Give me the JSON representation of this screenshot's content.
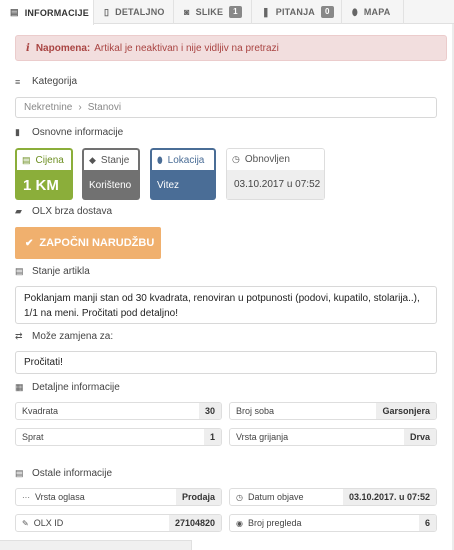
{
  "tabs": [
    {
      "label": "INFORMACIJE",
      "icon": "list-icon",
      "glyph": "▤",
      "active": true
    },
    {
      "label": "DETALJNO",
      "icon": "document-icon",
      "glyph": "▯",
      "active": false
    },
    {
      "label": "SLIKE",
      "icon": "camera-icon",
      "glyph": "◙",
      "badge": "1",
      "active": false
    },
    {
      "label": "PITANJA",
      "icon": "comments-icon",
      "glyph": "❚",
      "badge": "0",
      "active": false
    },
    {
      "label": "MAPA",
      "icon": "map-marker-icon",
      "glyph": "⬮",
      "active": false
    }
  ],
  "alert": {
    "bold": "Napomena:",
    "text": "Artikal je neaktivan i nije vidljiv na pretrazi",
    "icon": "info-icon",
    "glyph": "i"
  },
  "kategorija": {
    "heading": "Kategorija",
    "icon": "bars-icon",
    "glyph": "≡",
    "path": [
      "Nekretnine",
      "Stanovi"
    ],
    "separator": "›"
  },
  "osnovne": {
    "heading": "Osnovne informacije",
    "icon": "file-icon",
    "glyph": "▮",
    "cards": [
      {
        "label": "Cijena",
        "value": "1 KM",
        "icon": "money-icon",
        "glyph": "▤",
        "color": "#8bae3a"
      },
      {
        "label": "Stanje",
        "value": "Korišteno",
        "icon": "tag-icon",
        "glyph": "◆",
        "color": "#717171"
      },
      {
        "label": "Lokacija",
        "value": "Vitez",
        "icon": "map-pin-icon",
        "glyph": "⬮",
        "color": "#4a6d96"
      },
      {
        "label": "Obnovljen",
        "value": "03.10.2017 u 07:52",
        "icon": "clock-icon",
        "glyph": "◷",
        "color": "#eeeeee"
      }
    ]
  },
  "dostava": {
    "heading": "OLX brza dostava",
    "icon": "truck-icon",
    "glyph": "▰",
    "button": "ZAPOČNI NARUDŽBU",
    "button_icon": "check-icon",
    "button_glyph": "✔",
    "button_color": "#f0b06e"
  },
  "stanje": {
    "heading": "Stanje artikla",
    "icon": "file-text-icon",
    "glyph": "▤",
    "text": "Poklanjam manji stan od 30 kvadrata, renoviran u potpunosti (podovi, kupatilo, stolarija..), 1/1 na meni. Pročitati pod detaljno!"
  },
  "zamjena": {
    "heading": "Može zamjena za:",
    "icon": "exchange-icon",
    "glyph": "⇄",
    "value": "Pročitati!"
  },
  "detaljne": {
    "heading": "Detaljne informacije",
    "icon": "table-icon",
    "glyph": "▦",
    "items": [
      {
        "label": "Kvadrata",
        "value": "30"
      },
      {
        "label": "Broj soba",
        "value": "Garsonjera"
      },
      {
        "label": "Sprat",
        "value": "1"
      },
      {
        "label": "Vrsta grijanja",
        "value": "Drva"
      }
    ]
  },
  "ostale": {
    "heading": "Ostale informacije",
    "icon": "calculator-icon",
    "glyph": "▤",
    "items": [
      {
        "label": "Vrsta oglasa",
        "value": "Prodaja",
        "icon": "ellipsis-icon",
        "glyph": "···"
      },
      {
        "label": "Datum objave",
        "value": "03.10.2017. u 07:52",
        "icon": "clock-icon",
        "glyph": "◷"
      },
      {
        "label": "OLX ID",
        "value": "27104820",
        "icon": "wrench-icon",
        "glyph": "✎"
      },
      {
        "label": "Broj pregleda",
        "value": "6",
        "icon": "eye-icon",
        "glyph": "◉"
      }
    ]
  }
}
